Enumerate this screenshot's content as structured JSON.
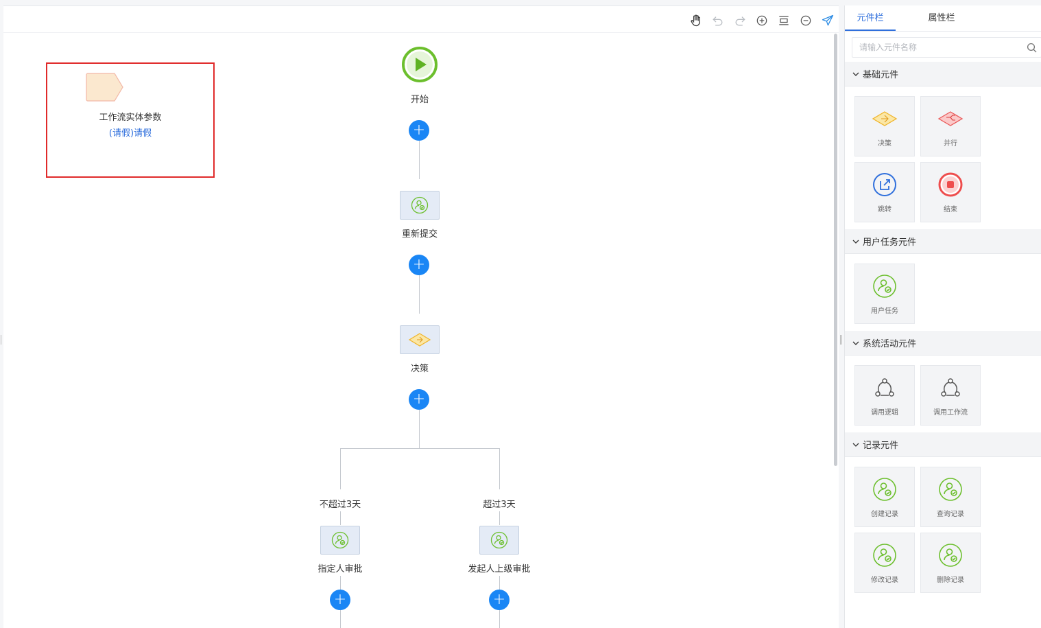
{
  "toolbar": {
    "tools": [
      {
        "name": "hand-tool",
        "icon": "hand-icon"
      },
      {
        "name": "undo-button",
        "icon": "undo-icon"
      },
      {
        "name": "redo-button",
        "icon": "redo-icon"
      },
      {
        "name": "zoom-in-button",
        "icon": "zoom-in-icon"
      },
      {
        "name": "fit-button",
        "icon": "fit-icon"
      },
      {
        "name": "zoom-out-button",
        "icon": "zoom-out-icon"
      },
      {
        "name": "publish-button",
        "icon": "send-icon"
      }
    ]
  },
  "entity": {
    "title": "工作流实体参数",
    "link": "(请假)请假"
  },
  "flow": {
    "start_label": "开始",
    "node1_label": "重新提交",
    "node2_label": "决策",
    "branch_left_label": "不超过3天",
    "branch_right_label": "超过3天",
    "node3_label": "指定人审批",
    "node4_label": "发起人上级审批",
    "add_symbol": "+"
  },
  "panel": {
    "tabs": [
      {
        "label": "元件栏",
        "active": true
      },
      {
        "label": "属性栏",
        "active": false
      }
    ],
    "search_placeholder": "请输入元件名称",
    "groups": [
      {
        "title": "基础元件",
        "items": [
          {
            "label": "决策",
            "icon": "decision-icon"
          },
          {
            "label": "并行",
            "icon": "parallel-icon"
          },
          {
            "label": "跳转",
            "icon": "jump-icon"
          },
          {
            "label": "结束",
            "icon": "end-icon"
          }
        ]
      },
      {
        "title": "用户任务元件",
        "items": [
          {
            "label": "用户任务",
            "icon": "user-task-icon"
          }
        ]
      },
      {
        "title": "系统活动元件",
        "items": [
          {
            "label": "调用逻辑",
            "icon": "call-logic-icon"
          },
          {
            "label": "调用工作流",
            "icon": "call-workflow-icon"
          }
        ]
      },
      {
        "title": "记录元件",
        "items": [
          {
            "label": "创建记录",
            "icon": "user-task-icon"
          },
          {
            "label": "查询记录",
            "icon": "user-task-icon"
          },
          {
            "label": "修改记录",
            "icon": "user-task-icon"
          },
          {
            "label": "删除记录",
            "icon": "user-task-icon"
          }
        ]
      }
    ]
  },
  "colors": {
    "accent": "#2f6fdc",
    "add_button": "#1a86f5",
    "start_green": "#6cbf2d",
    "highlight_red": "#e02a2a"
  }
}
